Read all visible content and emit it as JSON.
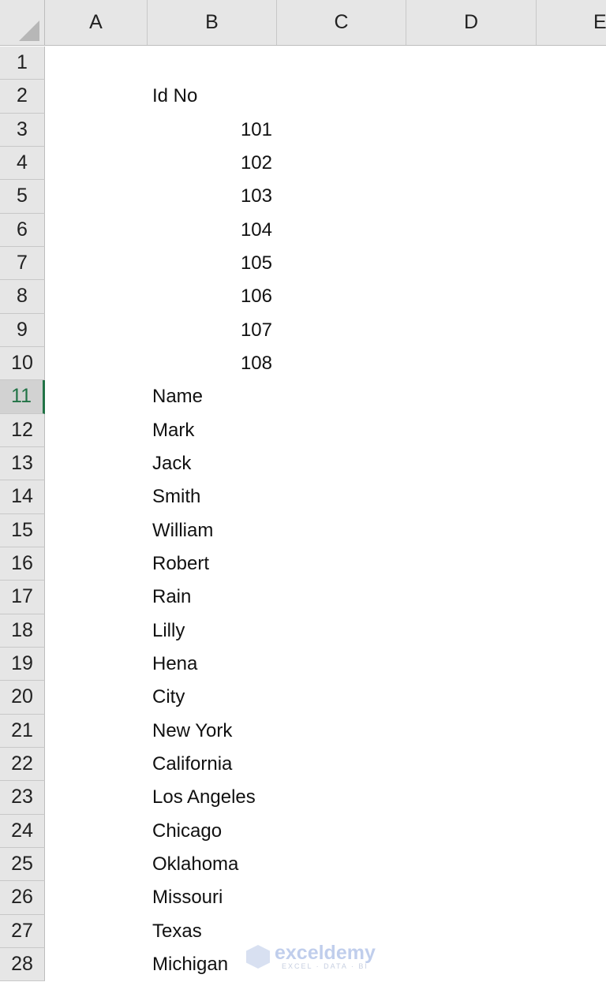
{
  "columns": [
    "A",
    "B",
    "C",
    "D",
    "E"
  ],
  "selected_row": 11,
  "accent_color": "#217346",
  "rows": [
    {
      "n": "1",
      "b": "",
      "num": false
    },
    {
      "n": "2",
      "b": "Id No",
      "num": false
    },
    {
      "n": "3",
      "b": "101",
      "num": true
    },
    {
      "n": "4",
      "b": "102",
      "num": true
    },
    {
      "n": "5",
      "b": "103",
      "num": true
    },
    {
      "n": "6",
      "b": "104",
      "num": true
    },
    {
      "n": "7",
      "b": "105",
      "num": true
    },
    {
      "n": "8",
      "b": "106",
      "num": true
    },
    {
      "n": "9",
      "b": "107",
      "num": true
    },
    {
      "n": "10",
      "b": "108",
      "num": true
    },
    {
      "n": "11",
      "b": "Name",
      "num": false
    },
    {
      "n": "12",
      "b": "Mark",
      "num": false
    },
    {
      "n": "13",
      "b": "Jack",
      "num": false
    },
    {
      "n": "14",
      "b": "Smith",
      "num": false
    },
    {
      "n": "15",
      "b": "William",
      "num": false
    },
    {
      "n": "16",
      "b": "Robert",
      "num": false
    },
    {
      "n": "17",
      "b": "Rain",
      "num": false
    },
    {
      "n": "18",
      "b": "Lilly",
      "num": false
    },
    {
      "n": "19",
      "b": "Hena",
      "num": false
    },
    {
      "n": "20",
      "b": "City",
      "num": false
    },
    {
      "n": "21",
      "b": "New York",
      "num": false
    },
    {
      "n": "22",
      "b": "California",
      "num": false
    },
    {
      "n": "23",
      "b": "Los Angeles",
      "num": false
    },
    {
      "n": "24",
      "b": "Chicago",
      "num": false
    },
    {
      "n": "25",
      "b": "Oklahoma",
      "num": false
    },
    {
      "n": "26",
      "b": "Missouri",
      "num": false
    },
    {
      "n": "27",
      "b": "Texas",
      "num": false
    },
    {
      "n": "28",
      "b": "Michigan",
      "num": false
    }
  ],
  "watermark": {
    "name": "exceldemy",
    "tagline": "EXCEL · DATA · BI"
  }
}
